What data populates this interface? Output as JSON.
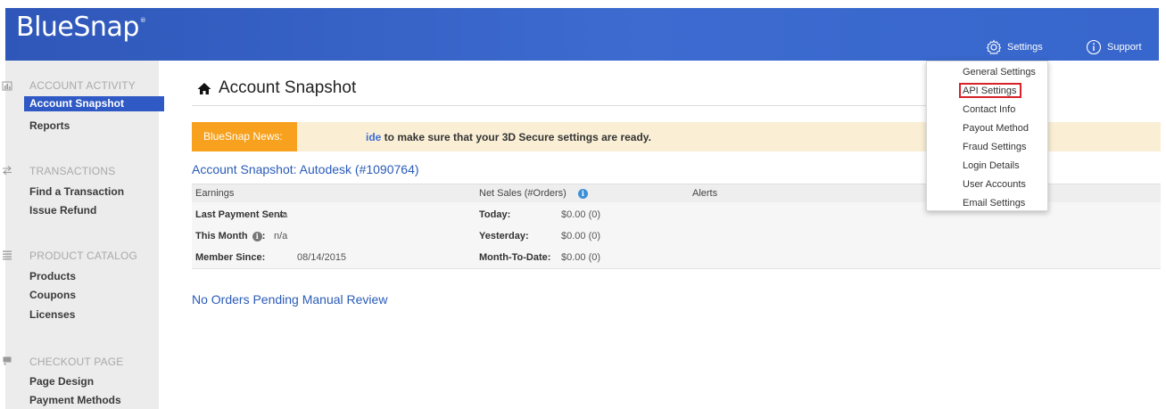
{
  "header": {
    "logo_text": "BlueSnap",
    "logo_mark": "®",
    "settings_label": "Settings",
    "support_label": "Support"
  },
  "sidebar": {
    "sections": [
      {
        "heading": "ACCOUNT ACTIVITY",
        "icon": "bar-chart-icon",
        "items": [
          "Account Snapshot",
          "Reports"
        ]
      },
      {
        "heading": "TRANSACTIONS",
        "icon": "transfer-arrows-icon",
        "items": [
          "Find a Transaction",
          "Issue Refund"
        ]
      },
      {
        "heading": "PRODUCT CATALOG",
        "icon": "list-icon",
        "items": [
          "Products",
          "Coupons",
          "Licenses"
        ]
      },
      {
        "heading": "CHECKOUT PAGE",
        "icon": "cart-icon",
        "items": [
          "Page Design",
          "Payment Methods"
        ]
      }
    ],
    "active_item": "Account Snapshot"
  },
  "main": {
    "page_title": "Account Snapshot",
    "news": {
      "label": "BlueSnap News:",
      "link_text": "ide",
      "text": " to make sure that your 3D Secure settings are ready."
    },
    "snapshot_title": "Account Snapshot: Autodesk (#1090764)",
    "table": {
      "headers": {
        "earnings": "Earnings",
        "net_sales": "Net Sales (#Orders)",
        "alerts": "Alerts"
      },
      "earnings_rows": [
        {
          "label": "Last Payment Sent:",
          "value": "n/a"
        },
        {
          "label": "This Month",
          "label_suffix": ":",
          "value": "n/a"
        },
        {
          "label": "Member Since:",
          "value": "08/14/2015"
        }
      ],
      "sales_rows": [
        {
          "label": "Today:",
          "value": "$0.00 (0)"
        },
        {
          "label": "Yesterday:",
          "value": "$0.00 (0)"
        },
        {
          "label": "Month-To-Date:",
          "value": "$0.00 (0)"
        }
      ]
    },
    "pending_text": "No Orders Pending Manual Review"
  },
  "settings_menu": {
    "items": [
      "General Settings",
      "API Settings",
      "Contact Info",
      "Payout Method",
      "Fraud Settings",
      "Login Details",
      "User Accounts",
      "Email Settings"
    ],
    "highlighted": "API Settings",
    "highlight_color": "#d7222a"
  },
  "colors": {
    "header_blue": "#3d6bd0",
    "active_blue": "#2f59c4",
    "news_orange": "#f7a11e",
    "link_blue": "#2a5bb8"
  }
}
